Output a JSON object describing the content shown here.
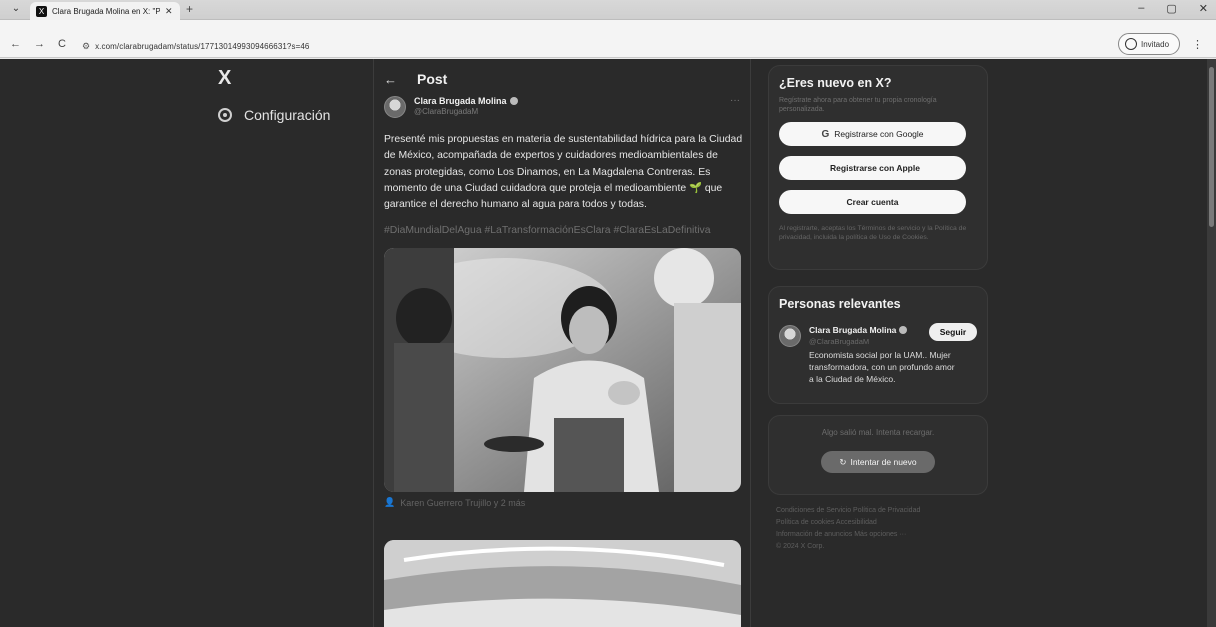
{
  "browser": {
    "tab_title": "Clara Brugada Molina en X: \"Pr…",
    "tab_list_glyph": "⌄",
    "tab_close_glyph": "✕",
    "new_tab_glyph": "+",
    "window_controls": [
      "–",
      "▢",
      "✕"
    ],
    "url": "x.com/clarabrugadam/status/1771301499309466631?s=46",
    "incognito_label": "Invitado",
    "nav": {
      "back": "←",
      "forward": "→",
      "reload": "C",
      "menu": "⋮"
    }
  },
  "left_nav": {
    "logo": "X",
    "settings_label": "Configuración"
  },
  "post": {
    "header_title": "Post",
    "back_glyph": "←",
    "author_name": "Clara Brugada Molina",
    "author_handle": "@ClaraBrugadaM",
    "more_glyph": "···",
    "text": "Presenté mis propuestas en materia de sustentabilidad hídrica para la Ciudad de México, acompañada de expertos y cuidadores medioambientales de zonas protegidas, como Los Dinamos, en La Magdalena Contreras. Es momento de una Ciudad cuidadora que proteja el medioambiente 🌱 que garantice el derecho humano al agua para todos y todas.",
    "hashtags": "#DiaMundialDelAgua #LaTransformaciónEsClara #ClaraEsLaDefinitiva",
    "photo_caption": "Karen Guerrero Trujillo y 2 más"
  },
  "signup": {
    "title": "¿Eres nuevo en X?",
    "subtitle": "Regístrate ahora para obtener tu propia cronología personalizada.",
    "google_label": "Registrarse con Google",
    "apple_label": "Registrarse con Apple",
    "create_label": "Crear cuenta",
    "legal": "Al registrarte, aceptas los Términos de servicio y la Política de privacidad, incluida la política de Uso de Cookies."
  },
  "people": {
    "title": "Personas relevantes",
    "name": "Clara Brugada Molina",
    "handle": "@ClaraBrugadaM",
    "bio": "Economista social por la UAM.. Mujer transformadora, con un profundo amor a la Ciudad de México.",
    "follow_label": "Seguir"
  },
  "error": {
    "text": "Algo salió mal. Intenta recargar.",
    "retry_label": "Intentar de nuevo"
  },
  "footer": {
    "lines": [
      "Condiciones de Servicio  Política de Privacidad",
      "Política de cookies  Accesibilidad",
      "Información de anuncios  Más opciones ···",
      "© 2024 X Corp."
    ]
  }
}
